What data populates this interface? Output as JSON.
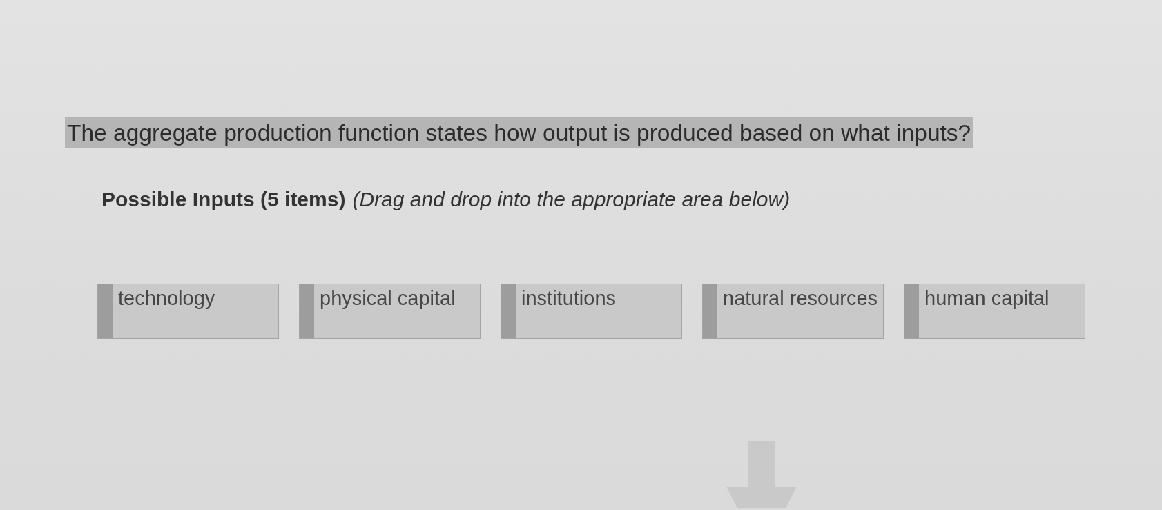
{
  "question": {
    "text": "The aggregate production function states how output is produced based on what inputs?",
    "highlighted": true
  },
  "instructions": {
    "heading": "Possible Inputs (5 items)",
    "hint": "(Drag and drop into the appropriate area below)"
  },
  "items": [
    {
      "label": "technology"
    },
    {
      "label": "physical capital"
    },
    {
      "label": "institutions"
    },
    {
      "label": "natural resources"
    },
    {
      "label": "human capital"
    }
  ]
}
